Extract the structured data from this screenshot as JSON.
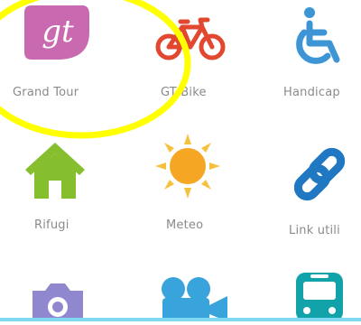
{
  "menu": {
    "items": [
      {
        "label": "Grand Tour",
        "icon": "grand-tour-icon",
        "icon_text": "gt",
        "color": "#c96ab0"
      },
      {
        "label": "GT Bike",
        "icon": "bicycle-icon",
        "color": "#e2472f"
      },
      {
        "label": "Handicap",
        "icon": "wheelchair-icon",
        "color": "#3d95d6"
      },
      {
        "label": "Rifugi",
        "icon": "house-icon",
        "color": "#86bf2e"
      },
      {
        "label": "Meteo",
        "icon": "sun-icon",
        "color": "#f5a623"
      },
      {
        "label": "Link utili",
        "icon": "link-icon",
        "color": "#1f78c1"
      },
      {
        "label": "",
        "icon": "camera-icon",
        "color": "#8f88cf"
      },
      {
        "label": "",
        "icon": "video-camera-icon",
        "color": "#39a3dc"
      },
      {
        "label": "",
        "icon": "bus-icon",
        "color": "#12a2a9"
      }
    ]
  },
  "annotation": {
    "shape": "yellow-ellipse",
    "color": "#ffff00"
  }
}
